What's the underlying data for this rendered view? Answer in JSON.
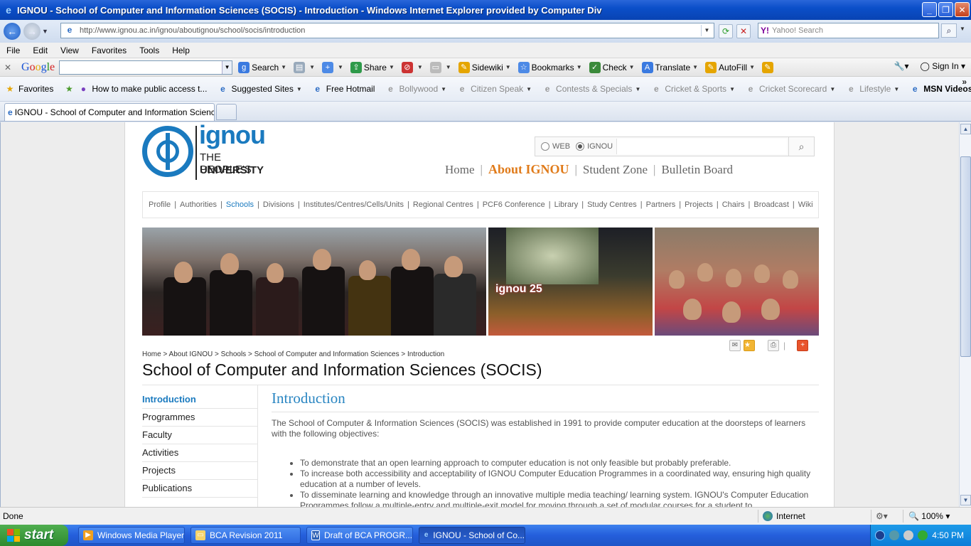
{
  "window": {
    "title": "IGNOU - School of Computer and Information Sciences (SOCIS) - Introduction - Windows Internet Explorer provided by Computer Div"
  },
  "address_bar": {
    "url": "http://www.ignou.ac.in/ignou/aboutignou/school/socis/introduction",
    "search_placeholder": "Yahoo! Search"
  },
  "menu": [
    "File",
    "Edit",
    "View",
    "Favorites",
    "Tools",
    "Help"
  ],
  "google_toolbar": {
    "logo": "Google",
    "items": [
      "Search",
      "Share",
      "Sidewiki",
      "Bookmarks",
      "Check",
      "Translate",
      "AutoFill"
    ],
    "sign_in": "Sign In"
  },
  "favorites_bar": {
    "favorites_label": "Favorites",
    "items": [
      "How to make public access t...",
      "Suggested Sites",
      "Free Hotmail",
      "Bollywood",
      "Citizen Speak",
      "Contests & Specials",
      "Cricket & Sports",
      "Cricket Scorecard",
      "Lifestyle",
      "MSN Videos"
    ]
  },
  "tab": {
    "label": "IGNOU - School of Computer and Information Science..."
  },
  "site": {
    "logo_name": "ignou",
    "logo_line1": "THE PEOPLE'S",
    "logo_line2": "UNIVERSITY",
    "search_options": [
      "WEB",
      "IGNOU"
    ],
    "top_nav": [
      "Home",
      "About IGNOU",
      "Student Zone",
      "Bulletin Board"
    ],
    "sub_nav": [
      "Profile",
      "Authorities",
      "Schools",
      "Divisions",
      "Institutes/Centres/Cells/Units",
      "Regional Centres",
      "PCF6 Conference",
      "Library",
      "Study Centres",
      "Partners",
      "Projects",
      "Chairs",
      "Broadcast",
      "Wiki"
    ],
    "banner_text": "ignou 25",
    "breadcrumb": "Home > About IGNOU > Schools > School of Computer and Information Sciences > Introduction",
    "page_title": "School of Computer and Information Sciences (SOCIS)",
    "left_nav": [
      "Introduction",
      "Programmes",
      "Faculty",
      "Activities",
      "Projects",
      "Publications"
    ],
    "content_heading": "Introduction",
    "intro": "The School of Computer & Information Sciences (SOCIS) was established in 1991 to provide computer education at the doorsteps of learners with the following objectives:",
    "objectives": [
      "To demonstrate that an open learning approach to computer education is not only feasible but probably preferable.",
      "To increase both accessibility and acceptability of IGNOU Computer Education Programmes in a coordinated way, ensuring high quality education at a number of levels.",
      "To disseminate learning and knowledge through an innovative multiple media teaching/ learning system. IGNOU's Computer Education Programmes follow a multiple-entry and multiple-exit model for moving through a set of modular courses for a student to"
    ]
  },
  "status_bar": {
    "status": "Done",
    "zone": "Internet",
    "zoom": "100%"
  },
  "taskbar": {
    "start": "start",
    "tasks": [
      "Windows Media Player",
      "BCA Revision 2011",
      "Draft of  BCA PROGR...",
      "IGNOU - School of Co..."
    ],
    "clock": "4:50 PM"
  }
}
